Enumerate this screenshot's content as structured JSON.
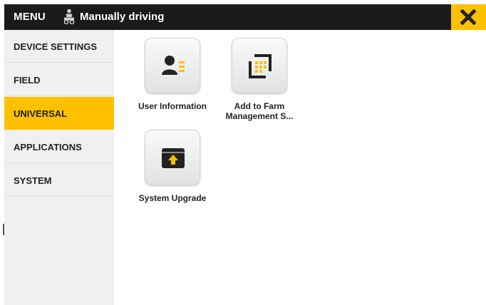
{
  "header": {
    "menu_label": "MENU",
    "status_text": "Manually driving",
    "status_icon": "tractor-driver-icon",
    "close_icon": "close-icon"
  },
  "sidebar": {
    "items": [
      {
        "label": "DEVICE SETTINGS",
        "active": false
      },
      {
        "label": "FIELD",
        "active": false
      },
      {
        "label": "UNIVERSAL",
        "active": true
      },
      {
        "label": "APPLICATIONS",
        "active": false
      },
      {
        "label": "SYSTEM",
        "active": false
      }
    ]
  },
  "main": {
    "apps": [
      {
        "label": "User Information",
        "icon": "user-info-icon"
      },
      {
        "label": "Add to Farm Management S...",
        "label_line1": "Add to Farm",
        "label_line2": "Management S...",
        "icon": "farm-management-icon"
      },
      {
        "label": "System Upgrade",
        "icon": "system-upgrade-icon"
      }
    ]
  },
  "colors": {
    "accent": "#ffc000",
    "header_bg": "#1a1a1a",
    "sidebar_bg": "#f0f0f0",
    "text": "#222222"
  }
}
